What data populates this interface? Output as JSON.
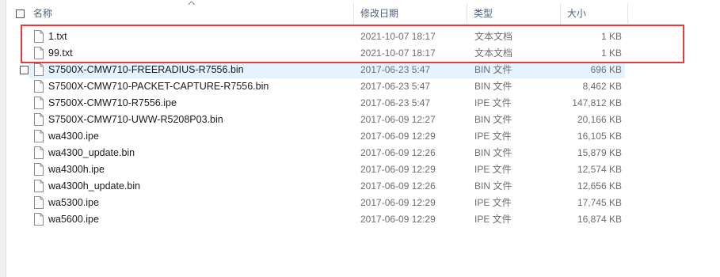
{
  "header": {
    "name": "名称",
    "date": "修改日期",
    "type": "类型",
    "size": "大小"
  },
  "files": [
    {
      "name": "1.txt",
      "date": "2021-10-07 18:17",
      "type": "文本文档",
      "size": "1 KB"
    },
    {
      "name": "99.txt",
      "date": "2021-10-07 18:17",
      "type": "文本文档",
      "size": "1 KB"
    },
    {
      "name": "S7500X-CMW710-FREERADIUS-R7556.bin",
      "date": "2017-06-23 5:47",
      "type": "BIN 文件",
      "size": "696 KB"
    },
    {
      "name": "S7500X-CMW710-PACKET-CAPTURE-R7556.bin",
      "date": "2017-06-23 5:47",
      "type": "BIN 文件",
      "size": "8,462 KB"
    },
    {
      "name": "S7500X-CMW710-R7556.ipe",
      "date": "2017-06-23 5:47",
      "type": "IPE 文件",
      "size": "147,812 KB"
    },
    {
      "name": "S7500X-CMW710-UWW-R5208P03.bin",
      "date": "2017-06-09 12:27",
      "type": "BIN 文件",
      "size": "20,166 KB"
    },
    {
      "name": "wa4300.ipe",
      "date": "2017-06-09 12:29",
      "type": "IPE 文件",
      "size": "16,105 KB"
    },
    {
      "name": "wa4300_update.bin",
      "date": "2017-06-09 12:26",
      "type": "BIN 文件",
      "size": "15,879 KB"
    },
    {
      "name": "wa4300h.ipe",
      "date": "2017-06-09 12:29",
      "type": "IPE 文件",
      "size": "12,574 KB"
    },
    {
      "name": "wa4300h_update.bin",
      "date": "2017-06-09 12:26",
      "type": "BIN 文件",
      "size": "12,656 KB"
    },
    {
      "name": "wa5300.ipe",
      "date": "2017-06-09 12:29",
      "type": "IPE 文件",
      "size": "17,745 KB"
    },
    {
      "name": "wa5600.ipe",
      "date": "2017-06-09 12:29",
      "type": "IPE 文件",
      "size": "16,874 KB"
    }
  ],
  "colors": {
    "highlight_border": "#e33a3a",
    "hover_row": "#e5f3ff",
    "header_text": "#4c607a"
  },
  "icons": {
    "file": "document-file-icon",
    "sort": "sort-ascending-icon"
  }
}
